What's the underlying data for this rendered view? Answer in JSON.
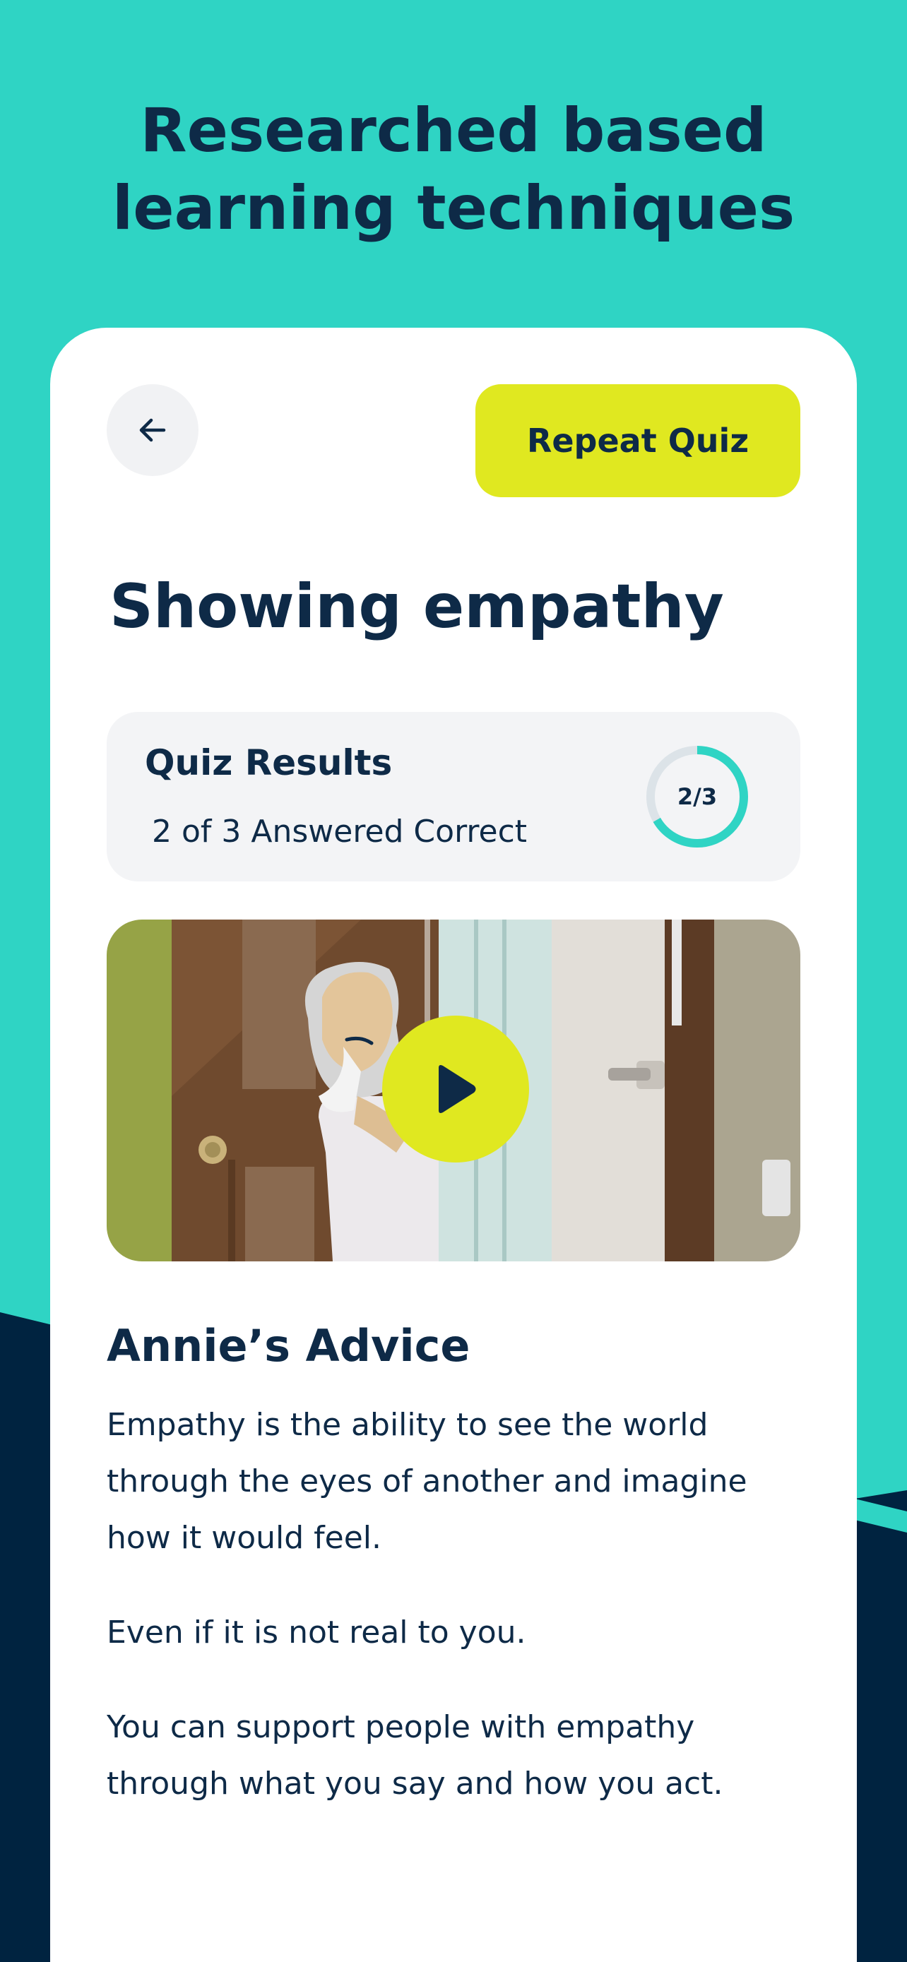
{
  "headline": {
    "line1": "Researched based",
    "line2": "learning techniques"
  },
  "toolbar": {
    "back_icon": "arrow-left-icon",
    "repeat_label": "Repeat Quiz"
  },
  "page_title": "Showing empathy",
  "quiz_results": {
    "title": "Quiz Results",
    "summary": "2 of 3 Answered Correct",
    "score_label": "2/3",
    "correct": 2,
    "total": 3
  },
  "video": {
    "play_icon": "play-icon"
  },
  "advice": {
    "title": "Annie’s Advice",
    "paragraphs": [
      "Empathy is the ability to see the world through the eyes of another and imagine how it would feel.",
      "Even if it is not real to you.",
      "You can support people with empathy through what you say and how you act."
    ]
  },
  "colors": {
    "teal_background": "#2FD4C4",
    "navy": "#0E2A47",
    "accent_yellow": "#E0E820",
    "card": "#FFFFFF",
    "panel_grey": "#F3F4F6"
  }
}
